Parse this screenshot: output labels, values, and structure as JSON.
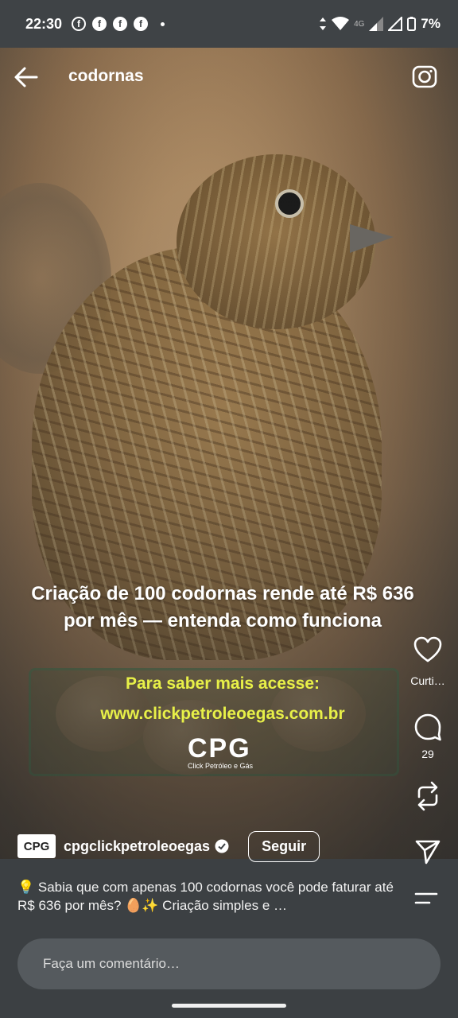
{
  "status_bar": {
    "time": "22:30",
    "notification_icons": [
      "facebook-outline-icon",
      "facebook-icon",
      "facebook-icon",
      "facebook-icon"
    ],
    "network_label": "4G",
    "battery": "7%"
  },
  "header": {
    "title": "codornas",
    "back_icon": "back-arrow-icon",
    "camera_icon": "camera-icon"
  },
  "post": {
    "headline": "Criação de 100 codornas rende até R$ 636 por mês — entenda como funciona",
    "cta_line1": "Para saber mais acesse:",
    "cta_line2": "www.clickpetroleoegas.com.br",
    "logo_text": "CPG",
    "logo_subtitle": "Click Petróleo e Gás"
  },
  "actions": {
    "like_label": "Curti…",
    "comment_count": "29"
  },
  "author": {
    "avatar_text": "CPG",
    "username": "cpgclickpetroleoegas",
    "follow_label": "Seguir"
  },
  "caption": {
    "text": "💡 Sabia que com apenas 100 codornas você pode faturar até R$ 636 por mês? 🥚✨ Criação simples e …"
  },
  "comment_input": {
    "placeholder": "Faça um comentário…"
  },
  "colors": {
    "cta_yellow": "#e8f048",
    "status_bar_bg": "#3f4346",
    "comment_bg": "#555a5e"
  }
}
